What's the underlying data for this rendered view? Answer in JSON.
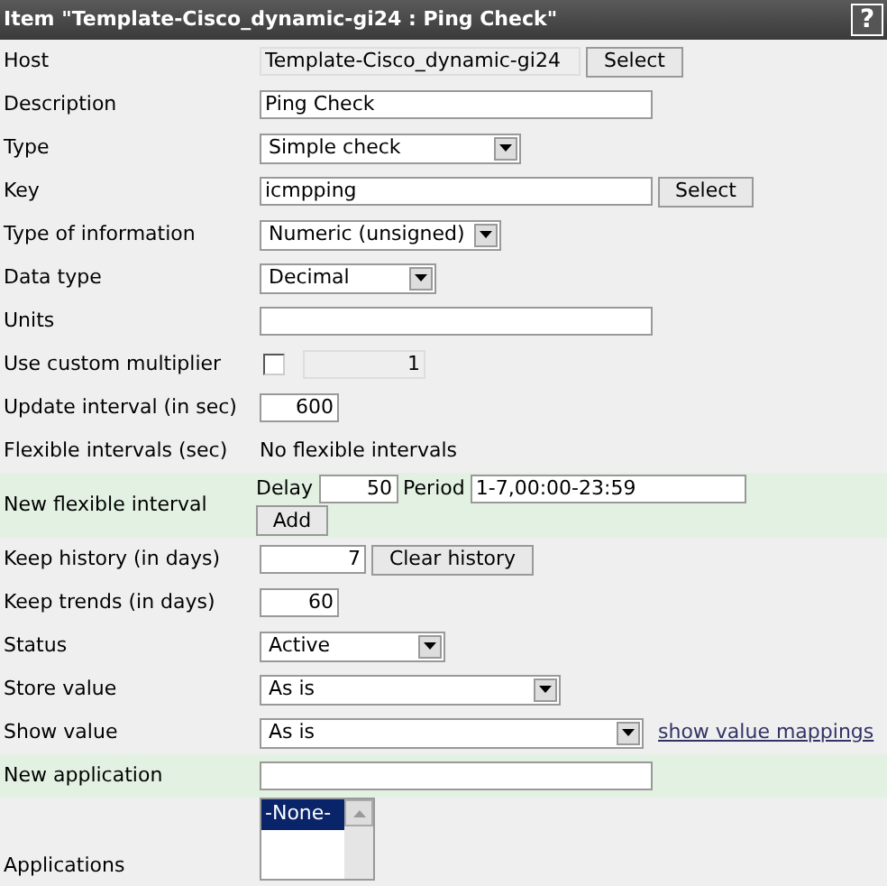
{
  "title": "Item \"Template-Cisco_dynamic-gi24 : Ping Check\"",
  "help_button": "?",
  "rows": [
    {
      "kind": "readonly_button",
      "label": "Host",
      "value": "Template-Cisco_dynamic-gi24",
      "button": "Select",
      "highlighted": false
    },
    {
      "kind": "text",
      "label": "Description",
      "value": "Ping Check",
      "highlighted": false
    },
    {
      "kind": "select",
      "label": "Type",
      "value": "Simple check",
      "highlighted": false
    },
    {
      "kind": "text_button",
      "label": "Key",
      "value": "icmpping",
      "button": "Select",
      "highlighted": false
    },
    {
      "kind": "select",
      "label": "Type of information",
      "value": "Numeric (unsigned)",
      "highlighted": false
    },
    {
      "kind": "select",
      "label": "Data type",
      "value": "Decimal",
      "highlighted": false
    },
    {
      "kind": "text",
      "label": "Units",
      "highlighted": false
    },
    {
      "kind": "checkbox_number",
      "label": "Use custom multiplier",
      "checked": false,
      "value": "1",
      "highlighted": false
    },
    {
      "kind": "number",
      "label": "Update interval (in sec)",
      "value": "600",
      "highlighted": false
    },
    {
      "kind": "plain",
      "label": "Flexible intervals (sec)",
      "value": "No flexible intervals",
      "highlighted": false
    },
    {
      "kind": "flex",
      "label": "New flexible interval",
      "delay_label": "Delay",
      "delay": "50",
      "period_label": "Period",
      "period": "1-7,00:00-23:59",
      "button": "Add",
      "highlighted": true
    },
    {
      "kind": "number_button",
      "label": "Keep history (in days)",
      "value": "7",
      "button": "Clear history",
      "highlighted": false
    },
    {
      "kind": "number",
      "label": "Keep trends (in days)",
      "value": "60",
      "highlighted": false
    },
    {
      "kind": "select",
      "label": "Status",
      "value": "Active",
      "highlighted": false
    },
    {
      "kind": "select",
      "label": "Store value",
      "value": "As is",
      "highlighted": false
    },
    {
      "kind": "select_link",
      "label": "Show value",
      "value": "As is",
      "link": "show value mappings",
      "highlighted": false
    },
    {
      "kind": "text",
      "label": "New application",
      "highlighted": true
    },
    {
      "kind": "listbox",
      "label": "Applications",
      "options": [
        {
          "label": "-None-",
          "selected": true
        }
      ],
      "highlighted": false
    }
  ]
}
